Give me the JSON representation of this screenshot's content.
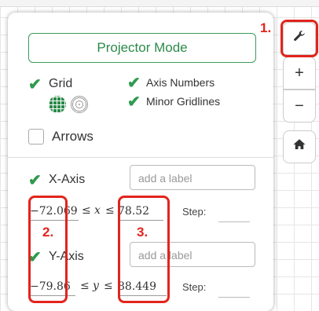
{
  "projector_button": "Projector Mode",
  "grid": {
    "label": "Grid"
  },
  "axis_numbers": {
    "label": "Axis Numbers"
  },
  "minor_gridlines": {
    "label": "Minor Gridlines"
  },
  "arrows": {
    "label": "Arrows"
  },
  "x_axis": {
    "label": "X-Axis",
    "placeholder": "add a label",
    "min": "−72.069",
    "max": "78.52",
    "var": "x",
    "step_label": "Step:"
  },
  "y_axis": {
    "label": "Y-Axis",
    "placeholder": "add a label",
    "min": "−79.86",
    "max": "88.449",
    "var": "y",
    "step_label": "Step:"
  },
  "leq": "≤",
  "annotations": {
    "one": "1.",
    "two": "2.",
    "three": "3."
  },
  "side": {
    "plus": "+",
    "minus": "−"
  },
  "colors": {
    "accent_green": "#2f9a4f",
    "annotation_red": "#e2241d"
  }
}
